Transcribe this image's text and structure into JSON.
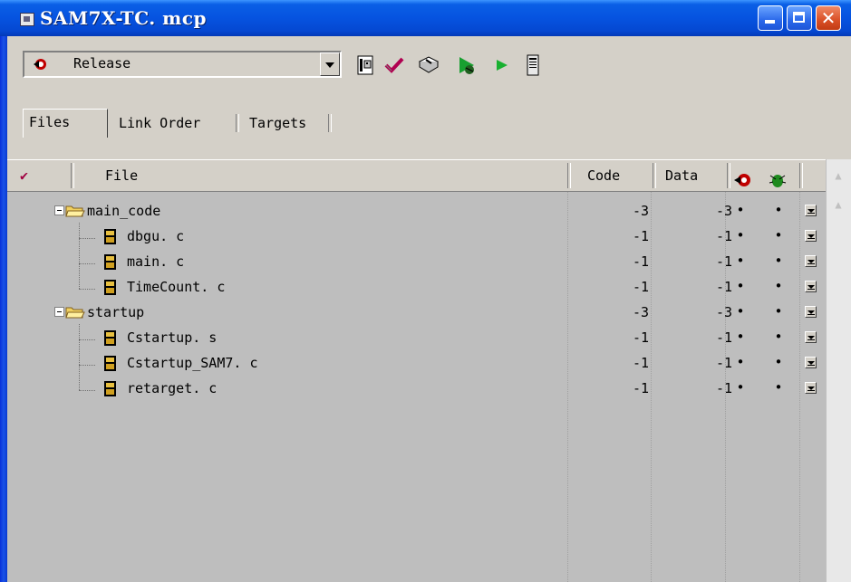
{
  "window": {
    "title": "SAM7X-TC. mcp"
  },
  "toolbar": {
    "target_selected": "Release",
    "tool_icons": [
      "target-settings-icon",
      "check-syntax-icon",
      "compile-icon",
      "make-icon",
      "run-icon",
      "project-inspector-icon"
    ]
  },
  "tabs": [
    {
      "label": "Files",
      "active": true
    },
    {
      "label": "Link Order",
      "active": false
    },
    {
      "label": "Targets",
      "active": false
    }
  ],
  "columns": {
    "check": "✔",
    "file": "File",
    "code": "Code",
    "data": "Data",
    "target_icon": "target-icon",
    "debug_icon": "debug-bug-icon"
  },
  "rows": [
    {
      "name": "main_code",
      "kind": "group",
      "code": "-3",
      "data": "-3",
      "dot1": "•",
      "dot2": "•"
    },
    {
      "name": "dbgu. c",
      "kind": "file",
      "code": "-1",
      "data": "-1",
      "dot1": "•",
      "dot2": "•"
    },
    {
      "name": "main. c",
      "kind": "file",
      "code": "-1",
      "data": "-1",
      "dot1": "•",
      "dot2": "•"
    },
    {
      "name": "TimeCount. c",
      "kind": "file",
      "code": "-1",
      "data": "-1",
      "dot1": "•",
      "dot2": "•"
    },
    {
      "name": "startup",
      "kind": "group",
      "code": "-3",
      "data": "-3",
      "dot1": "•",
      "dot2": "•"
    },
    {
      "name": "Cstartup. s",
      "kind": "file",
      "code": "-1",
      "data": "-1",
      "dot1": "•",
      "dot2": "•"
    },
    {
      "name": "Cstartup_SAM7. c",
      "kind": "file",
      "code": "-1",
      "data": "-1",
      "dot1": "•",
      "dot2": "•"
    },
    {
      "name": "retarget. c",
      "kind": "file",
      "code": "-1",
      "data": "-1",
      "dot1": "•",
      "dot2": "•"
    }
  ],
  "colors": {
    "title_blue": "#0653e0",
    "panel_gray": "#bebebe",
    "face": "#d4d0c8",
    "close_red": "#d94f26"
  }
}
